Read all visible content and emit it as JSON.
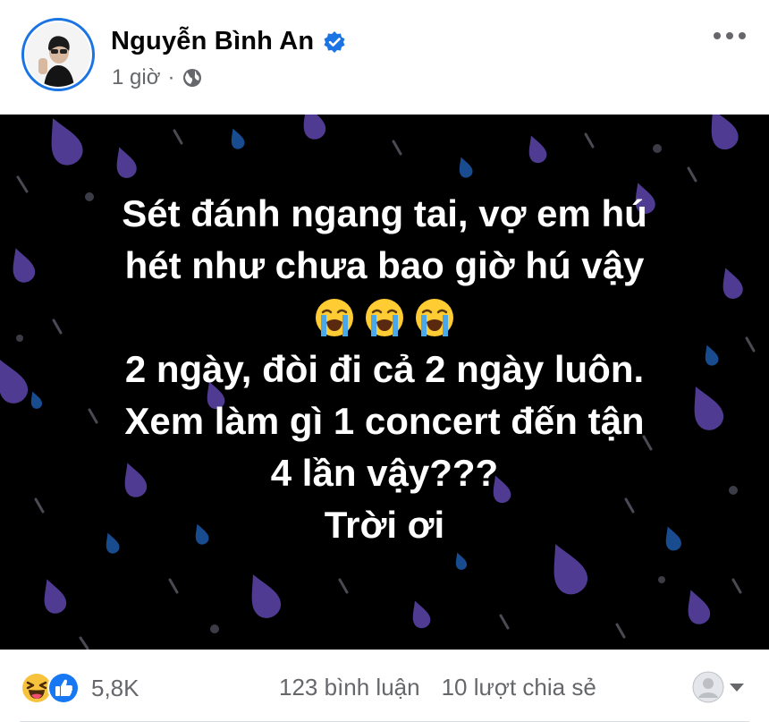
{
  "author": {
    "name": "Nguyễn Bình An",
    "verified": true,
    "avatar": "avatar-photo"
  },
  "meta": {
    "time": "1 giờ",
    "separator": "·",
    "audience_icon": "globe-icon"
  },
  "post": {
    "background_color": "#000000",
    "text_color": "#ffffff",
    "lines": [
      "Sét đánh ngang tai, vợ em hú",
      "hét như chưa bao giờ hú vậy",
      "2 ngày, đòi đi cả 2 ngày luôn.",
      "Xem làm gì 1 concert đến tận",
      "4 lần vậy???",
      "Trời ơi"
    ],
    "emoji": [
      "loudly-crying-face",
      "loudly-crying-face",
      "loudly-crying-face"
    ]
  },
  "footer": {
    "reaction_icons": [
      "haha-icon",
      "like-icon"
    ],
    "reaction_count": "5,8K",
    "comments": "123 bình luận",
    "shares": "10 lượt chia sẻ"
  },
  "colors": {
    "accent": "#1b74e4",
    "secondary_text": "#65676b"
  }
}
